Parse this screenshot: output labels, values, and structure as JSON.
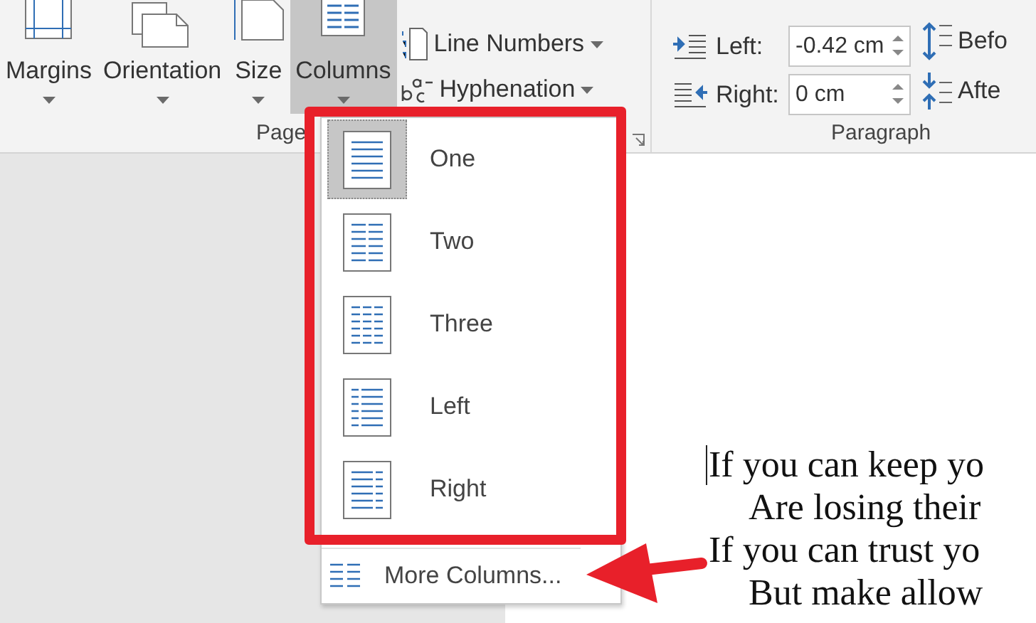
{
  "ribbon": {
    "page_setup": {
      "large_buttons": [
        {
          "label": "Margins",
          "kind": "margins",
          "selected": false
        },
        {
          "label": "Orientation",
          "kind": "orientation",
          "selected": false
        },
        {
          "label": "Size",
          "kind": "size",
          "selected": false
        },
        {
          "label": "Columns",
          "kind": "columns",
          "selected": true
        }
      ],
      "small_buttons": [
        {
          "label": "Line Numbers",
          "kind": "line-numbers"
        },
        {
          "label": "Hyphenation",
          "kind": "hyphenation"
        }
      ],
      "group_label": "Page"
    },
    "paragraph": {
      "indent": [
        {
          "label": "Left:",
          "kind": "left",
          "value": "-0.42 cm"
        },
        {
          "label": "Right:",
          "kind": "right",
          "value": "0 cm"
        }
      ],
      "spacing": [
        {
          "label": "Befo",
          "kind": "before"
        },
        {
          "label": "Afte",
          "kind": "after"
        }
      ],
      "group_label": "Paragraph"
    }
  },
  "columns_menu": {
    "items": [
      {
        "label": "One",
        "kind": "one",
        "selected": true
      },
      {
        "label": "Two",
        "kind": "two",
        "selected": false
      },
      {
        "label": "Three",
        "kind": "three",
        "selected": false
      },
      {
        "label": "Left",
        "kind": "left",
        "selected": false
      },
      {
        "label": "Right",
        "kind": "right",
        "selected": false
      }
    ],
    "more": {
      "label": "More Columns..."
    }
  },
  "document": {
    "lines": [
      {
        "text": "If you can keep yo",
        "indented": false
      },
      {
        "text": "Are losing their",
        "indented": true
      },
      {
        "text": "If you can trust yo",
        "indented": false
      },
      {
        "text": "But make allow",
        "indented": true
      }
    ]
  }
}
